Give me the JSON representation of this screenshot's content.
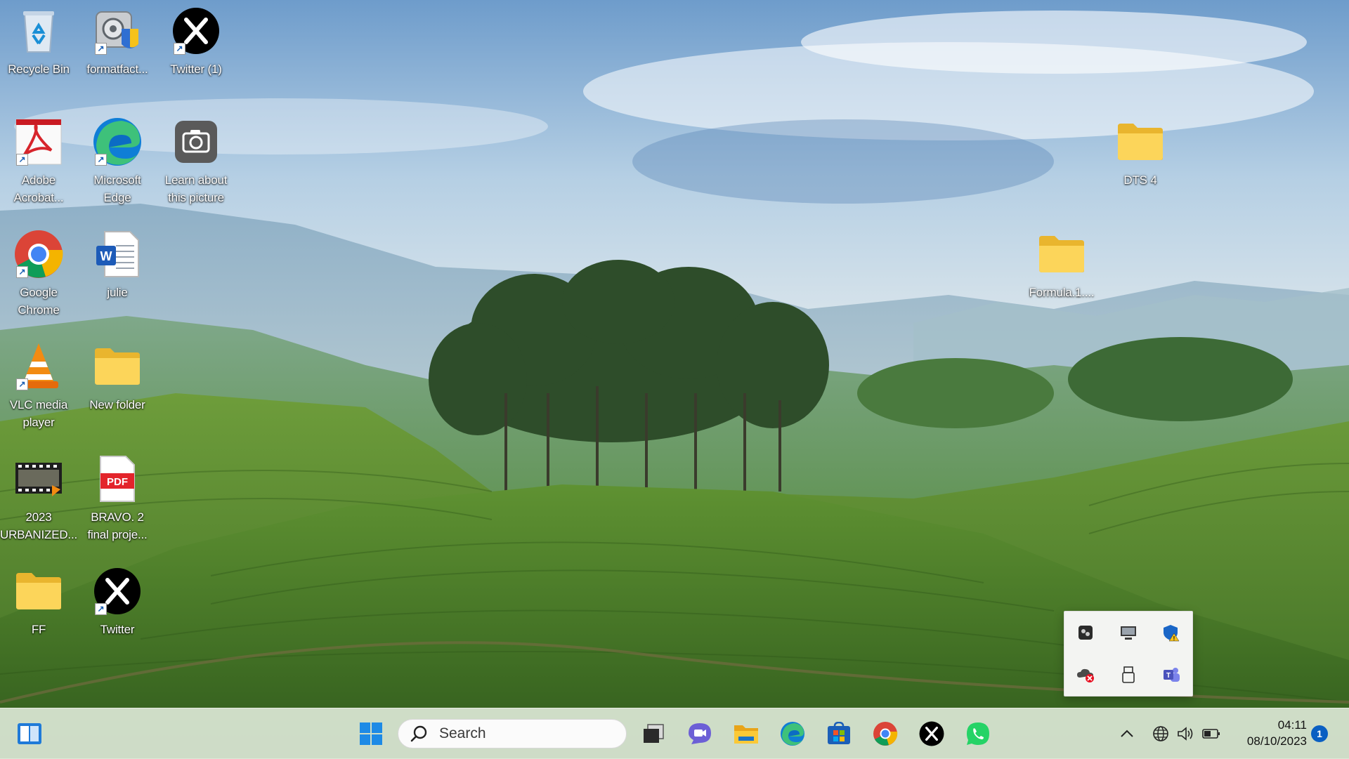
{
  "desktop": {
    "icons": [
      {
        "label": "Recycle Bin",
        "icon": "recycle-bin-icon"
      },
      {
        "label": "formatfact...",
        "icon": "format-factory-icon"
      },
      {
        "label": "Twitter (1)",
        "icon": "x-twitter-icon"
      },
      {
        "label": "Adobe Acrobat...",
        "icon": "adobe-acrobat-icon"
      },
      {
        "label": "Microsoft Edge",
        "icon": "edge-icon"
      },
      {
        "label": "Learn about this picture",
        "icon": "camera-icon"
      },
      {
        "label": "Google Chrome",
        "icon": "chrome-icon"
      },
      {
        "label": "julie",
        "icon": "word-document-icon"
      },
      {
        "label": "VLC media player",
        "icon": "vlc-icon"
      },
      {
        "label": "New folder",
        "icon": "folder-icon"
      },
      {
        "label": "2023 URBANIZED...",
        "icon": "video-file-icon"
      },
      {
        "label": "BRAVO. 2 final proje...",
        "icon": "pdf-file-icon"
      },
      {
        "label": "FF",
        "icon": "folder-icon"
      },
      {
        "label": "Twitter",
        "icon": "x-twitter-icon"
      },
      {
        "label": "DTS 4",
        "icon": "folder-icon"
      },
      {
        "label": "Formula.1....",
        "icon": "folder-icon"
      }
    ]
  },
  "tray_overflow": {
    "items": [
      "app-tray-icon",
      "display-tray-icon",
      "security-warning-icon",
      "onedrive-error-icon",
      "usb-drive-icon",
      "teams-icon"
    ]
  },
  "taskbar": {
    "search_placeholder": "Search",
    "pinned": [
      "task-view-icon",
      "chat-icon",
      "file-explorer-icon",
      "edge-icon",
      "store-icon",
      "chrome-icon",
      "x-twitter-icon",
      "whatsapp-icon"
    ],
    "clock_time": "04:11",
    "clock_date": "08/10/2023",
    "notification_count": "1"
  },
  "colors": {
    "accent": "#0a5fc2",
    "folder": "#f4c542"
  }
}
